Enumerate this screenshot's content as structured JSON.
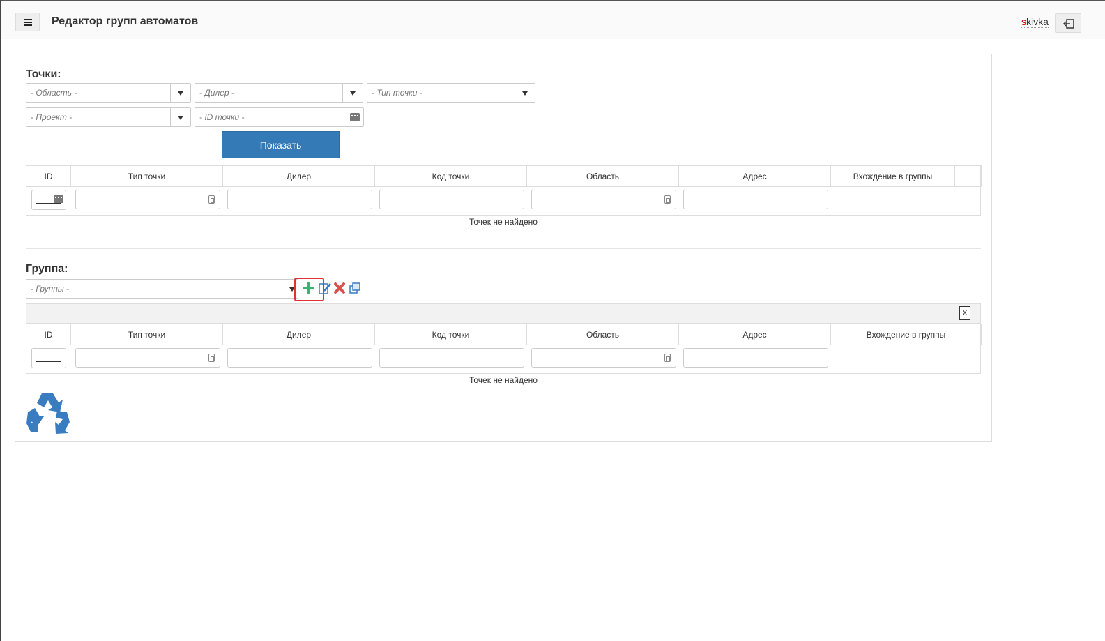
{
  "header": {
    "title": "Редактор групп автоматов",
    "user_first": "s",
    "user_rest": "kivka"
  },
  "points": {
    "title": "Точки:",
    "filters": {
      "region_placeholder": "- Область -",
      "dealer_placeholder": "- Дилер -",
      "type_placeholder": "- Тип точки -",
      "project_placeholder": "- Проект -",
      "id_placeholder": "- ID точки -"
    },
    "show_button": "Показать",
    "table": {
      "columns": [
        "ID",
        "Тип точки",
        "Дилер",
        "Код точки",
        "Область",
        "Адрес",
        "Вхождение в группы"
      ],
      "empty_message": "Точек не найдено"
    }
  },
  "group": {
    "title": "Группа:",
    "select_placeholder": "- Группы -",
    "table": {
      "columns": [
        "ID",
        "Тип точки",
        "Дилер",
        "Код точки",
        "Область",
        "Адрес",
        "Вхождение в группы"
      ],
      "empty_message": "Точек не найдено"
    }
  },
  "icons": {
    "add": "plus-icon",
    "edit": "edit-icon",
    "delete": "delete-icon",
    "copy": "copy-icon",
    "export": "excel-icon",
    "recycle": "recycle-icon"
  },
  "colors": {
    "primary": "#337ab7",
    "add": "#3cb371",
    "delete": "#d9534f",
    "recycle": "#3a7cc0",
    "highlight": "#dd3333"
  }
}
